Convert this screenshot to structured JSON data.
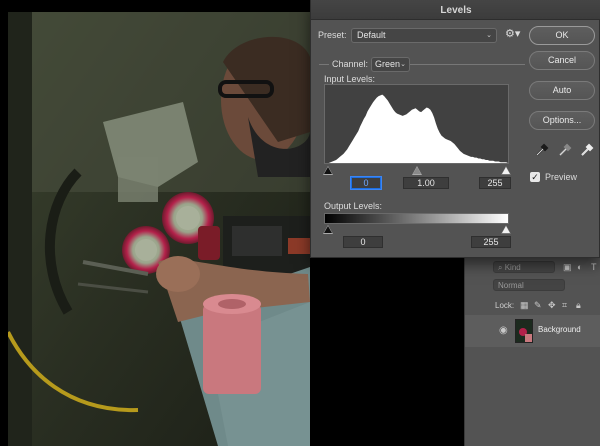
{
  "dialog": {
    "title": "Levels",
    "preset_label": "Preset:",
    "preset_value": "Default",
    "channel_label": "Channel:",
    "channel_value": "Green",
    "input_levels_label": "Input Levels:",
    "output_levels_label": "Output Levels:",
    "input_black": "0",
    "input_gamma": "1.00",
    "input_white": "255",
    "output_black": "0",
    "output_white": "255",
    "buttons": {
      "ok": "OK",
      "cancel": "Cancel",
      "auto": "Auto",
      "options": "Options..."
    },
    "preview_label": "Preview",
    "preview_checked": true,
    "histogram": [
      0,
      0,
      0,
      1,
      2,
      3,
      4,
      6,
      8,
      10,
      12,
      15,
      18,
      22,
      26,
      30,
      34,
      38,
      42,
      48,
      53,
      58,
      62,
      68,
      72,
      76,
      80,
      83,
      86,
      88,
      89,
      90,
      88,
      85,
      82,
      78,
      74,
      70,
      67,
      65,
      64,
      63,
      62,
      63,
      64,
      66,
      68,
      70,
      71,
      72,
      70,
      68,
      67,
      69,
      71,
      73,
      72,
      70,
      66,
      60,
      52,
      45,
      40,
      36,
      34,
      32,
      31,
      30,
      29,
      27,
      25,
      22,
      19,
      16,
      14,
      12,
      11,
      10,
      9,
      8,
      8,
      7,
      7,
      6,
      6,
      5,
      5,
      4,
      4,
      3,
      3,
      3,
      2,
      2,
      2,
      1,
      1,
      1,
      1,
      0
    ]
  },
  "layers_panel": {
    "kind_label": "Kind",
    "blend_mode": "Normal",
    "lock_label": "Lock:",
    "layer_name": "Background"
  },
  "colors": {
    "dialog_bg": "#535353",
    "accent_focus": "#1f6fe0"
  }
}
